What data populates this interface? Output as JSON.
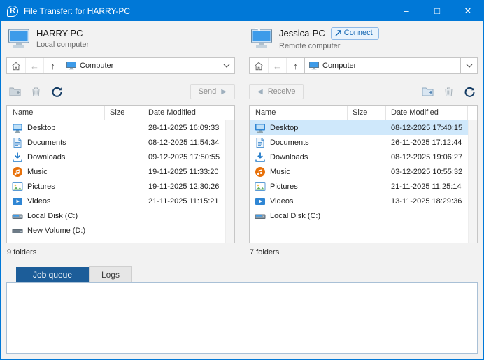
{
  "window": {
    "title": "File Transfer: for HARRY-PC"
  },
  "colors": {
    "titlebar": "#0078d7",
    "selection": "#cfe8fb",
    "tab_active": "#1c5d99",
    "connect_text": "#0d62b0"
  },
  "columns": {
    "name": "Name",
    "size": "Size",
    "date": "Date Modified"
  },
  "left_panel": {
    "computer_name": "HARRY-PC",
    "computer_type": "Local computer",
    "path": "Computer",
    "send_label": "Send",
    "status": "9 folders",
    "rows": [
      {
        "icon": "desktop-icon",
        "name": "Desktop",
        "size": "",
        "date": "28-11-2025 16:09:33"
      },
      {
        "icon": "documents-icon",
        "name": "Documents",
        "size": "",
        "date": "08-12-2025 11:54:34"
      },
      {
        "icon": "downloads-icon",
        "name": "Downloads",
        "size": "",
        "date": "09-12-2025 17:50:55"
      },
      {
        "icon": "music-icon",
        "name": "Music",
        "size": "",
        "date": "19-11-2025 11:33:20"
      },
      {
        "icon": "pictures-icon",
        "name": "Pictures",
        "size": "",
        "date": "19-11-2025 12:30:26"
      },
      {
        "icon": "videos-icon",
        "name": "Videos",
        "size": "",
        "date": "21-11-2025 11:15:21"
      },
      {
        "icon": "disk-c-icon",
        "name": "Local Disk (C:)",
        "size": "",
        "date": ""
      },
      {
        "icon": "disk-d-icon",
        "name": "New Volume (D:)",
        "size": "",
        "date": ""
      }
    ]
  },
  "right_panel": {
    "computer_name": "Jessica-PC",
    "computer_type": "Remote computer",
    "connect_label": "Connect",
    "path": "Computer",
    "receive_label": "Receive",
    "status": "7 folders",
    "rows": [
      {
        "icon": "desktop-icon",
        "name": "Desktop",
        "size": "",
        "date": "08-12-2025 17:40:15",
        "selected": true
      },
      {
        "icon": "documents-icon",
        "name": "Documents",
        "size": "",
        "date": "26-11-2025 17:12:44"
      },
      {
        "icon": "downloads-icon",
        "name": "Downloads",
        "size": "",
        "date": "08-12-2025 19:06:27"
      },
      {
        "icon": "music-icon",
        "name": "Music",
        "size": "",
        "date": "03-12-2025 10:55:32"
      },
      {
        "icon": "pictures-icon",
        "name": "Pictures",
        "size": "",
        "date": "21-11-2025 11:25:14"
      },
      {
        "icon": "videos-icon",
        "name": "Videos",
        "size": "",
        "date": "13-11-2025 18:29:36"
      },
      {
        "icon": "disk-c-icon",
        "name": "Local Disk (C:)",
        "size": "",
        "date": ""
      }
    ]
  },
  "tabs": {
    "job_queue": "Job queue",
    "logs": "Logs"
  }
}
